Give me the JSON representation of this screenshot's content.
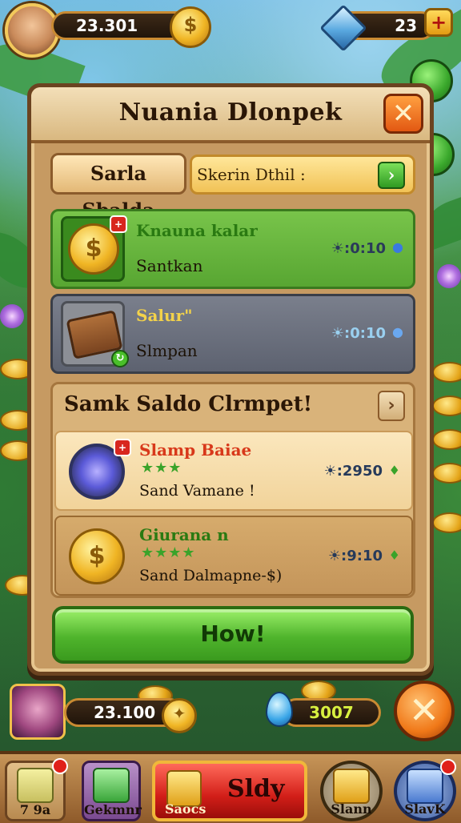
{
  "top_bar": {
    "coins": "23.301",
    "coin_symbol": "$",
    "gems": "23",
    "plus_symbol": "+"
  },
  "panel": {
    "title": "Nuania Dlonpek",
    "close_symbol": "✕",
    "tab_label": "Sarla Sbalda",
    "tab_input_text": "Skerin Dthil :",
    "tab_go_symbol": "›",
    "cards": [
      {
        "title": "Knauna kalar",
        "subtitle": "Santkan",
        "time": "☀:0:10",
        "title_color": "#2a7a12"
      },
      {
        "title": "Salur\"",
        "subtitle": "Slmpan",
        "time": "☀:0:10",
        "title_color": "#f3d24a"
      }
    ],
    "section": {
      "title": "Samk Saldo Clrmpet!",
      "arrow_symbol": "›",
      "items": [
        {
          "title": "Slamp Baiae",
          "stars": "★★★",
          "desc": "Sand Vamane !",
          "time": "☀:2950",
          "title_color": "#d8381a"
        },
        {
          "title": "Giurana n",
          "stars": "★★★★",
          "desc": "Sand Dalmapne-$)",
          "time": "☀:9:10",
          "title_color": "#2a7a12"
        }
      ]
    },
    "action_button": "How!"
  },
  "hud": {
    "coins": "23.100",
    "gems": "3007",
    "close_symbol": "✕"
  },
  "bottom_bar": {
    "slots": [
      {
        "label": "7   9a"
      },
      {
        "label": "Gekmnr"
      },
      {
        "label": "Saocs",
        "main_text": "Sldy"
      },
      {
        "label": "Slann"
      },
      {
        "label": "SlavK"
      }
    ]
  },
  "colors": {
    "panel_bg": "#c69a62",
    "accent_green": "#58a632",
    "accent_orange": "#e25812",
    "gold": "#f0b524"
  }
}
